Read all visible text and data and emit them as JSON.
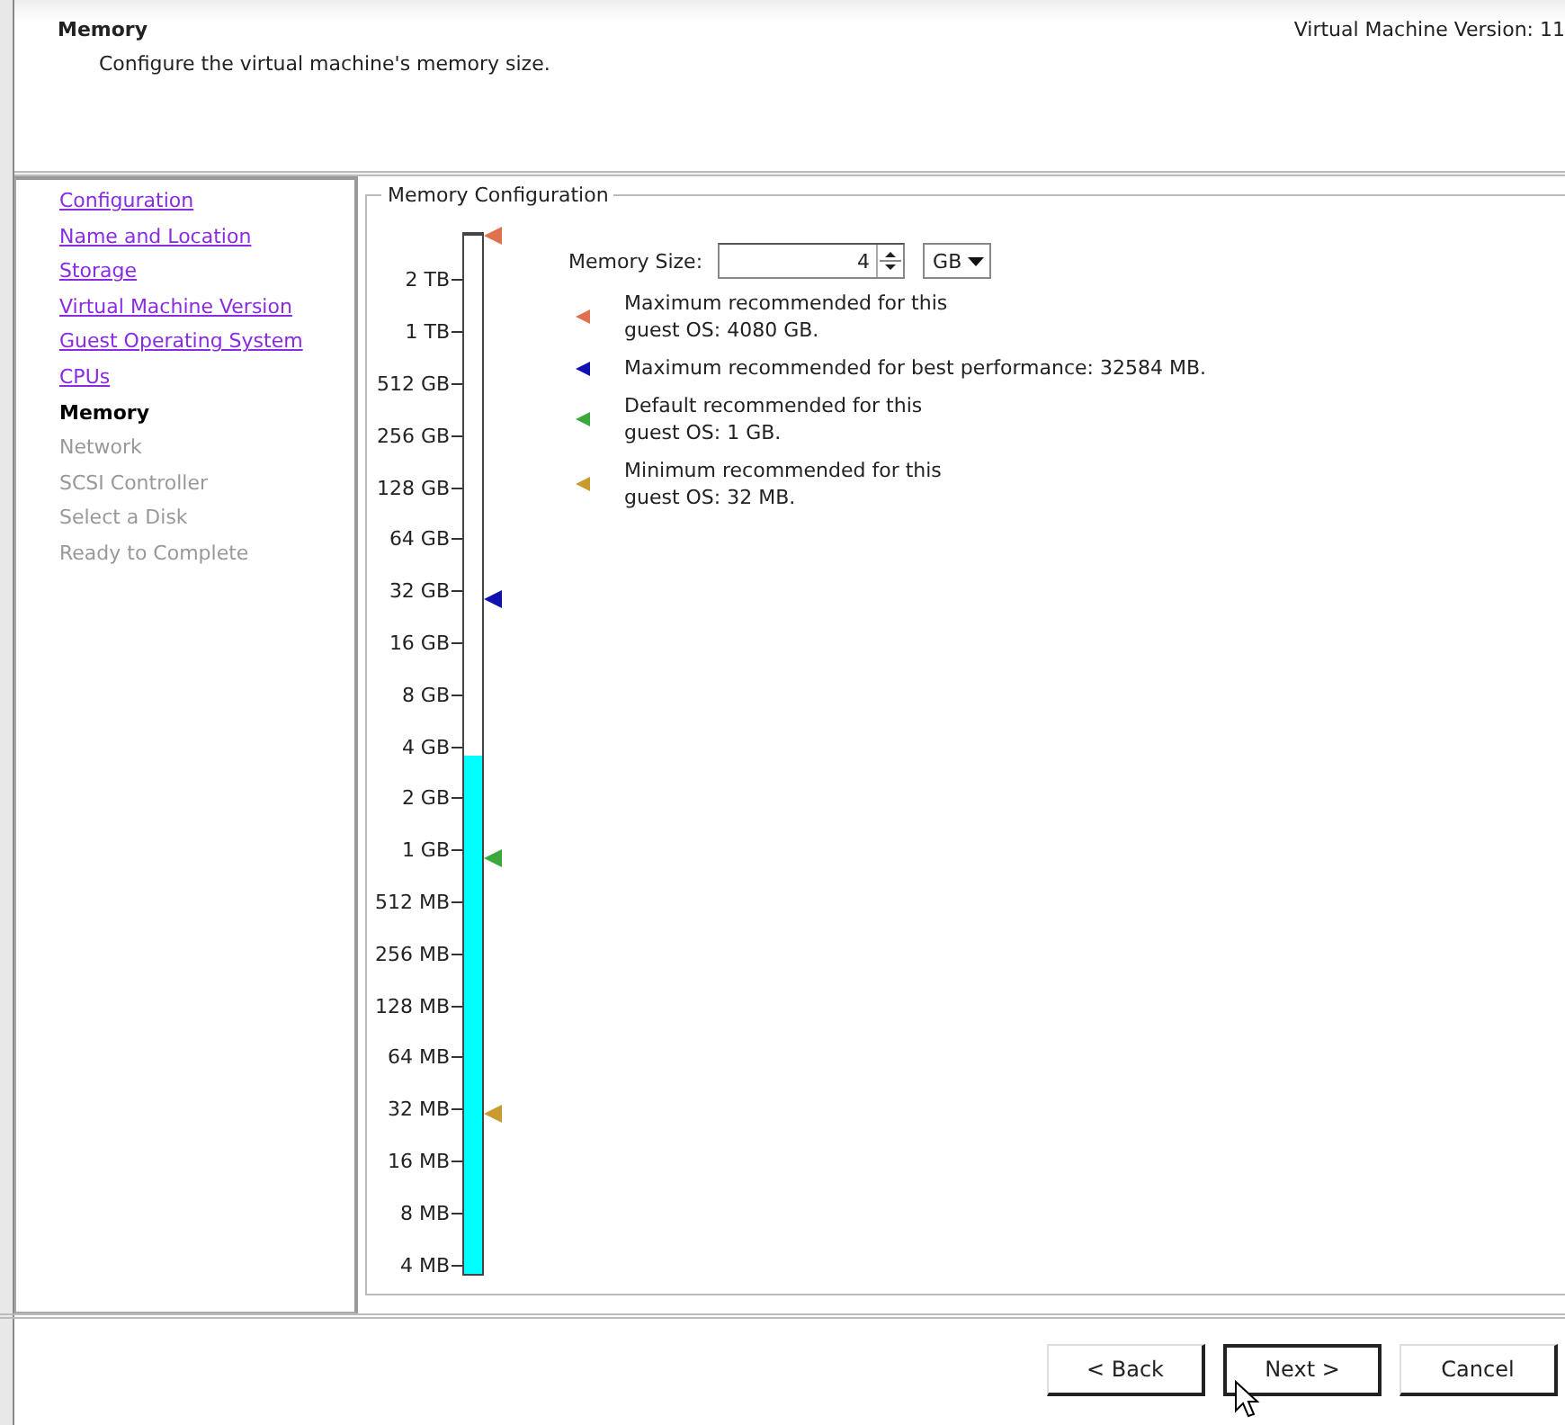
{
  "header": {
    "title": "Memory",
    "subtitle": "Configure the virtual machine's memory size.",
    "version": "Virtual Machine Version: 11"
  },
  "steps": [
    {
      "label": "Configuration",
      "visited": true,
      "selected": false
    },
    {
      "label": "Name and Location",
      "visited": true,
      "selected": false
    },
    {
      "label": "Storage",
      "visited": true,
      "selected": false
    },
    {
      "label": "Virtual Machine Version",
      "visited": true,
      "selected": false
    },
    {
      "label": "Guest Operating System",
      "visited": true,
      "selected": false
    },
    {
      "label": "CPUs",
      "visited": true,
      "selected": false
    },
    {
      "label": "Memory",
      "visited": false,
      "selected": true
    },
    {
      "label": "Network",
      "visited": false,
      "selected": false
    },
    {
      "label": "SCSI Controller",
      "visited": false,
      "selected": false
    },
    {
      "label": "Select a Disk",
      "visited": false,
      "selected": false
    },
    {
      "label": "Ready to Complete",
      "visited": false,
      "selected": false
    }
  ],
  "memory_configuration": {
    "title": "Memory Configuration",
    "size_label": "Memory Size:",
    "size_value": "4",
    "unit": "GB",
    "scale": {
      "level": 0.5,
      "ticks": [
        "2 TB",
        "1 TB",
        "512 GB",
        "256 GB",
        "128 GB",
        "64 GB",
        "32 GB",
        "16 GB",
        "8 GB",
        "4 GB",
        "2 GB",
        "1 GB",
        "512 MB",
        "256 MB",
        "128 MB",
        "64 MB",
        "32 MB",
        "16 MB",
        "8 MB",
        "4 MB"
      ]
    },
    "recommendations": [
      {
        "text": "Maximum recommended for this\nguest OS: 4080 GB.",
        "color": "#e0714f",
        "level": 1
      },
      {
        "text": "Maximum recommended for best performance: 32584 MB.",
        "color": "#1010b0",
        "level": 0.65
      },
      {
        "text": "Default recommended for this\nguest OS: 1 GB.",
        "color": "#3aa83a",
        "level": 0.4
      },
      {
        "text": "Minimum recommended for this\nguest OS: 32 MB.",
        "color": "#c89a30",
        "level": 0.155
      }
    ]
  },
  "buttons": [
    {
      "label": "< Back",
      "focused": false
    },
    {
      "label": "Next >",
      "focused": true
    },
    {
      "label": "Cancel",
      "focused": false
    }
  ]
}
